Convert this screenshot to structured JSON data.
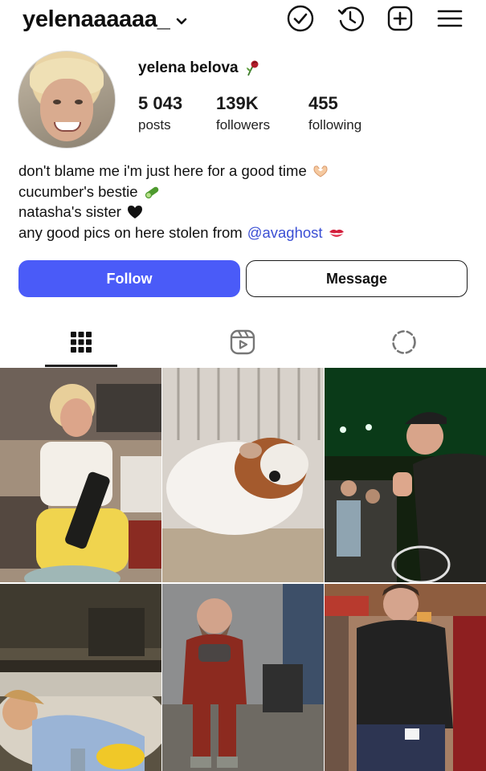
{
  "header": {
    "username": "yelenaaaaaa_",
    "icons": [
      "chevron-down-icon",
      "check-circle-icon",
      "history-icon",
      "add-post-icon",
      "menu-icon"
    ]
  },
  "profile": {
    "display_name": "yelena belova",
    "name_emoji": "wilted-rose-icon",
    "stats": [
      {
        "value": "5 043",
        "label": "posts"
      },
      {
        "value": "139K",
        "label": "followers"
      },
      {
        "value": "455",
        "label": "following"
      }
    ],
    "bio": {
      "line1": "don't blame me i'm just here for a good time",
      "line2": "cucumber's bestie",
      "line3": "natasha's sister",
      "line4_text": "any good pics on here stolen from",
      "line4_mention": "@avaghost"
    }
  },
  "actions": {
    "follow_label": "Follow",
    "message_label": "Message"
  },
  "tabs": [
    "grid-icon",
    "reels-icon",
    "dashed-circle-icon"
  ],
  "colors": {
    "follow_button": "#4a5bf8",
    "mention": "#3b4fd4"
  }
}
